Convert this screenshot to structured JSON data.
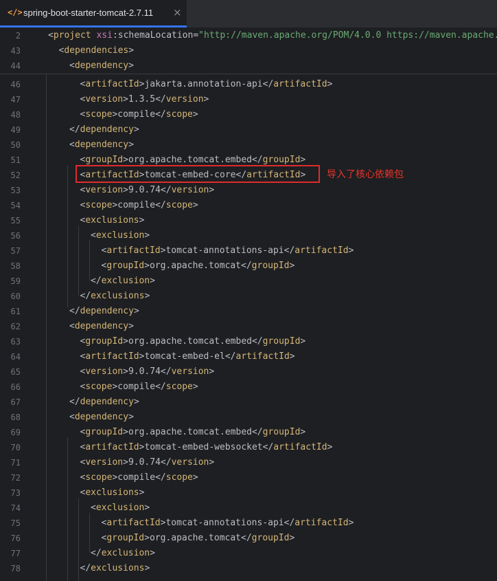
{
  "tab": {
    "icon": "</>",
    "title": "spring-boot-starter-tomcat-2.7.11",
    "close": "×"
  },
  "sticky_lines": [
    {
      "num": "2",
      "text": "<project xsi:schemaLocation=\"http://maven.apache.org/POM/4.0.0 https://maven.apache.",
      "kind": "project"
    },
    {
      "num": "43",
      "text": "<dependencies>",
      "kind": "open",
      "indent": 1,
      "tag": "dependencies"
    },
    {
      "num": "44",
      "text": "<dependency>",
      "kind": "open",
      "indent": 2,
      "tag": "dependency"
    }
  ],
  "lines": [
    {
      "num": "46",
      "indent": 3,
      "tag": "artifactId",
      "content": "jakarta.annotation-api"
    },
    {
      "num": "47",
      "indent": 3,
      "tag": "version",
      "content": "1.3.5"
    },
    {
      "num": "48",
      "indent": 3,
      "tag": "scope",
      "content": "compile"
    },
    {
      "num": "49",
      "indent": 2,
      "close": "dependency"
    },
    {
      "num": "50",
      "indent": 2,
      "open": "dependency"
    },
    {
      "num": "51",
      "indent": 3,
      "tag": "groupId",
      "content": "org.apache.tomcat.embed"
    },
    {
      "num": "52",
      "indent": 3,
      "tag": "artifactId",
      "content": "tomcat-embed-core"
    },
    {
      "num": "53",
      "indent": 3,
      "tag": "version",
      "content": "9.0.74"
    },
    {
      "num": "54",
      "indent": 3,
      "tag": "scope",
      "content": "compile"
    },
    {
      "num": "55",
      "indent": 3,
      "open": "exclusions"
    },
    {
      "num": "56",
      "indent": 4,
      "open": "exclusion"
    },
    {
      "num": "57",
      "indent": 5,
      "tag": "artifactId",
      "content": "tomcat-annotations-api"
    },
    {
      "num": "58",
      "indent": 5,
      "tag": "groupId",
      "content": "org.apache.tomcat"
    },
    {
      "num": "59",
      "indent": 4,
      "close": "exclusion"
    },
    {
      "num": "60",
      "indent": 3,
      "close": "exclusions"
    },
    {
      "num": "61",
      "indent": 2,
      "close": "dependency"
    },
    {
      "num": "62",
      "indent": 2,
      "open": "dependency"
    },
    {
      "num": "63",
      "indent": 3,
      "tag": "groupId",
      "content": "org.apache.tomcat.embed"
    },
    {
      "num": "64",
      "indent": 3,
      "tag": "artifactId",
      "content": "tomcat-embed-el"
    },
    {
      "num": "65",
      "indent": 3,
      "tag": "version",
      "content": "9.0.74"
    },
    {
      "num": "66",
      "indent": 3,
      "tag": "scope",
      "content": "compile"
    },
    {
      "num": "67",
      "indent": 2,
      "close": "dependency"
    },
    {
      "num": "68",
      "indent": 2,
      "open": "dependency"
    },
    {
      "num": "69",
      "indent": 3,
      "tag": "groupId",
      "content": "org.apache.tomcat.embed"
    },
    {
      "num": "70",
      "indent": 3,
      "tag": "artifactId",
      "content": "tomcat-embed-websocket"
    },
    {
      "num": "71",
      "indent": 3,
      "tag": "version",
      "content": "9.0.74"
    },
    {
      "num": "72",
      "indent": 3,
      "tag": "scope",
      "content": "compile"
    },
    {
      "num": "73",
      "indent": 3,
      "open": "exclusions"
    },
    {
      "num": "74",
      "indent": 4,
      "open": "exclusion"
    },
    {
      "num": "75",
      "indent": 5,
      "tag": "artifactId",
      "content": "tomcat-annotations-api"
    },
    {
      "num": "76",
      "indent": 5,
      "tag": "groupId",
      "content": "org.apache.tomcat"
    },
    {
      "num": "77",
      "indent": 4,
      "close": "exclusion"
    },
    {
      "num": "78",
      "indent": 3,
      "close": "exclusions"
    }
  ],
  "annotation": {
    "text": "导入了核心依赖包",
    "color": "#e8342a"
  },
  "colors": {
    "background": "#1e1f22",
    "tag": "#d5b778",
    "text": "#bcbec4",
    "namespace": "#c77dbb",
    "string": "#6aab73",
    "line_number": "#6f737a",
    "accent": "#3574f0"
  }
}
